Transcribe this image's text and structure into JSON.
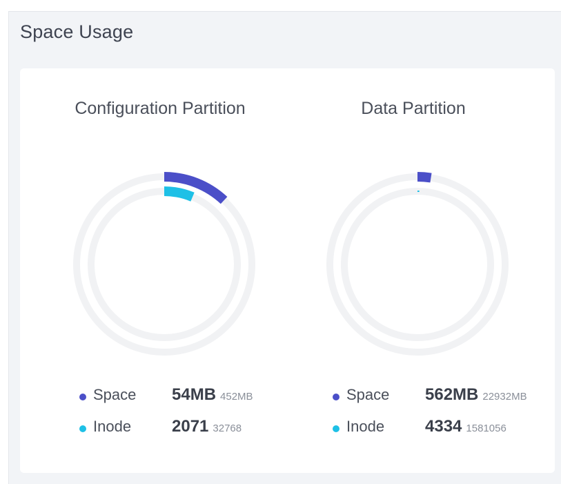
{
  "panel": {
    "title": "Space Usage"
  },
  "colors": {
    "space": "#4b4fc8",
    "inode": "#1ec0e6",
    "track": "#f1f2f4"
  },
  "partitions": [
    {
      "title": "Configuration Partition",
      "space": {
        "label": "Space",
        "used": "54MB",
        "total": "452MB",
        "used_mb": 54,
        "total_mb": 452
      },
      "inode": {
        "label": "Inode",
        "used": "2071",
        "total": "32768",
        "used_n": 2071,
        "total_n": 32768
      }
    },
    {
      "title": "Data Partition",
      "space": {
        "label": "Space",
        "used": "562MB",
        "total": "22932MB",
        "used_mb": 562,
        "total_mb": 22932
      },
      "inode": {
        "label": "Inode",
        "used": "4334",
        "total": "1581056",
        "used_n": 4334,
        "total_n": 1581056
      }
    }
  ]
}
